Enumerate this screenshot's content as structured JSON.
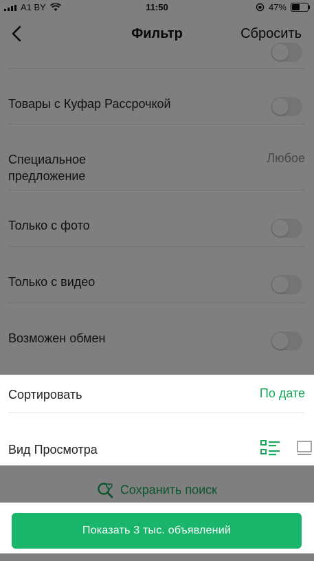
{
  "status_bar": {
    "carrier": "A1 BY",
    "time": "11:50",
    "battery": "47%"
  },
  "nav": {
    "title": "Фильтр",
    "reset_label": "Сбросить"
  },
  "filters": {
    "installment_label": "Товары с Куфар Рассрочкой",
    "special_offer_label_line1": "Специальное",
    "special_offer_label_line2": "предложение",
    "special_offer_value": "Любое",
    "photo_only_label": "Только с фото",
    "video_only_label": "Только с видео",
    "exchange_label": "Возможен обмен"
  },
  "sort": {
    "label": "Сортировать",
    "value": "По дате"
  },
  "view_mode": {
    "label": "Вид Просмотра",
    "selected": "list-icon"
  },
  "save_search_label": "Сохранить поиск",
  "show_button_label": "Показать 3 тыс. объявлений",
  "colors": {
    "accent": "#17a85b",
    "button": "#19b56a"
  }
}
